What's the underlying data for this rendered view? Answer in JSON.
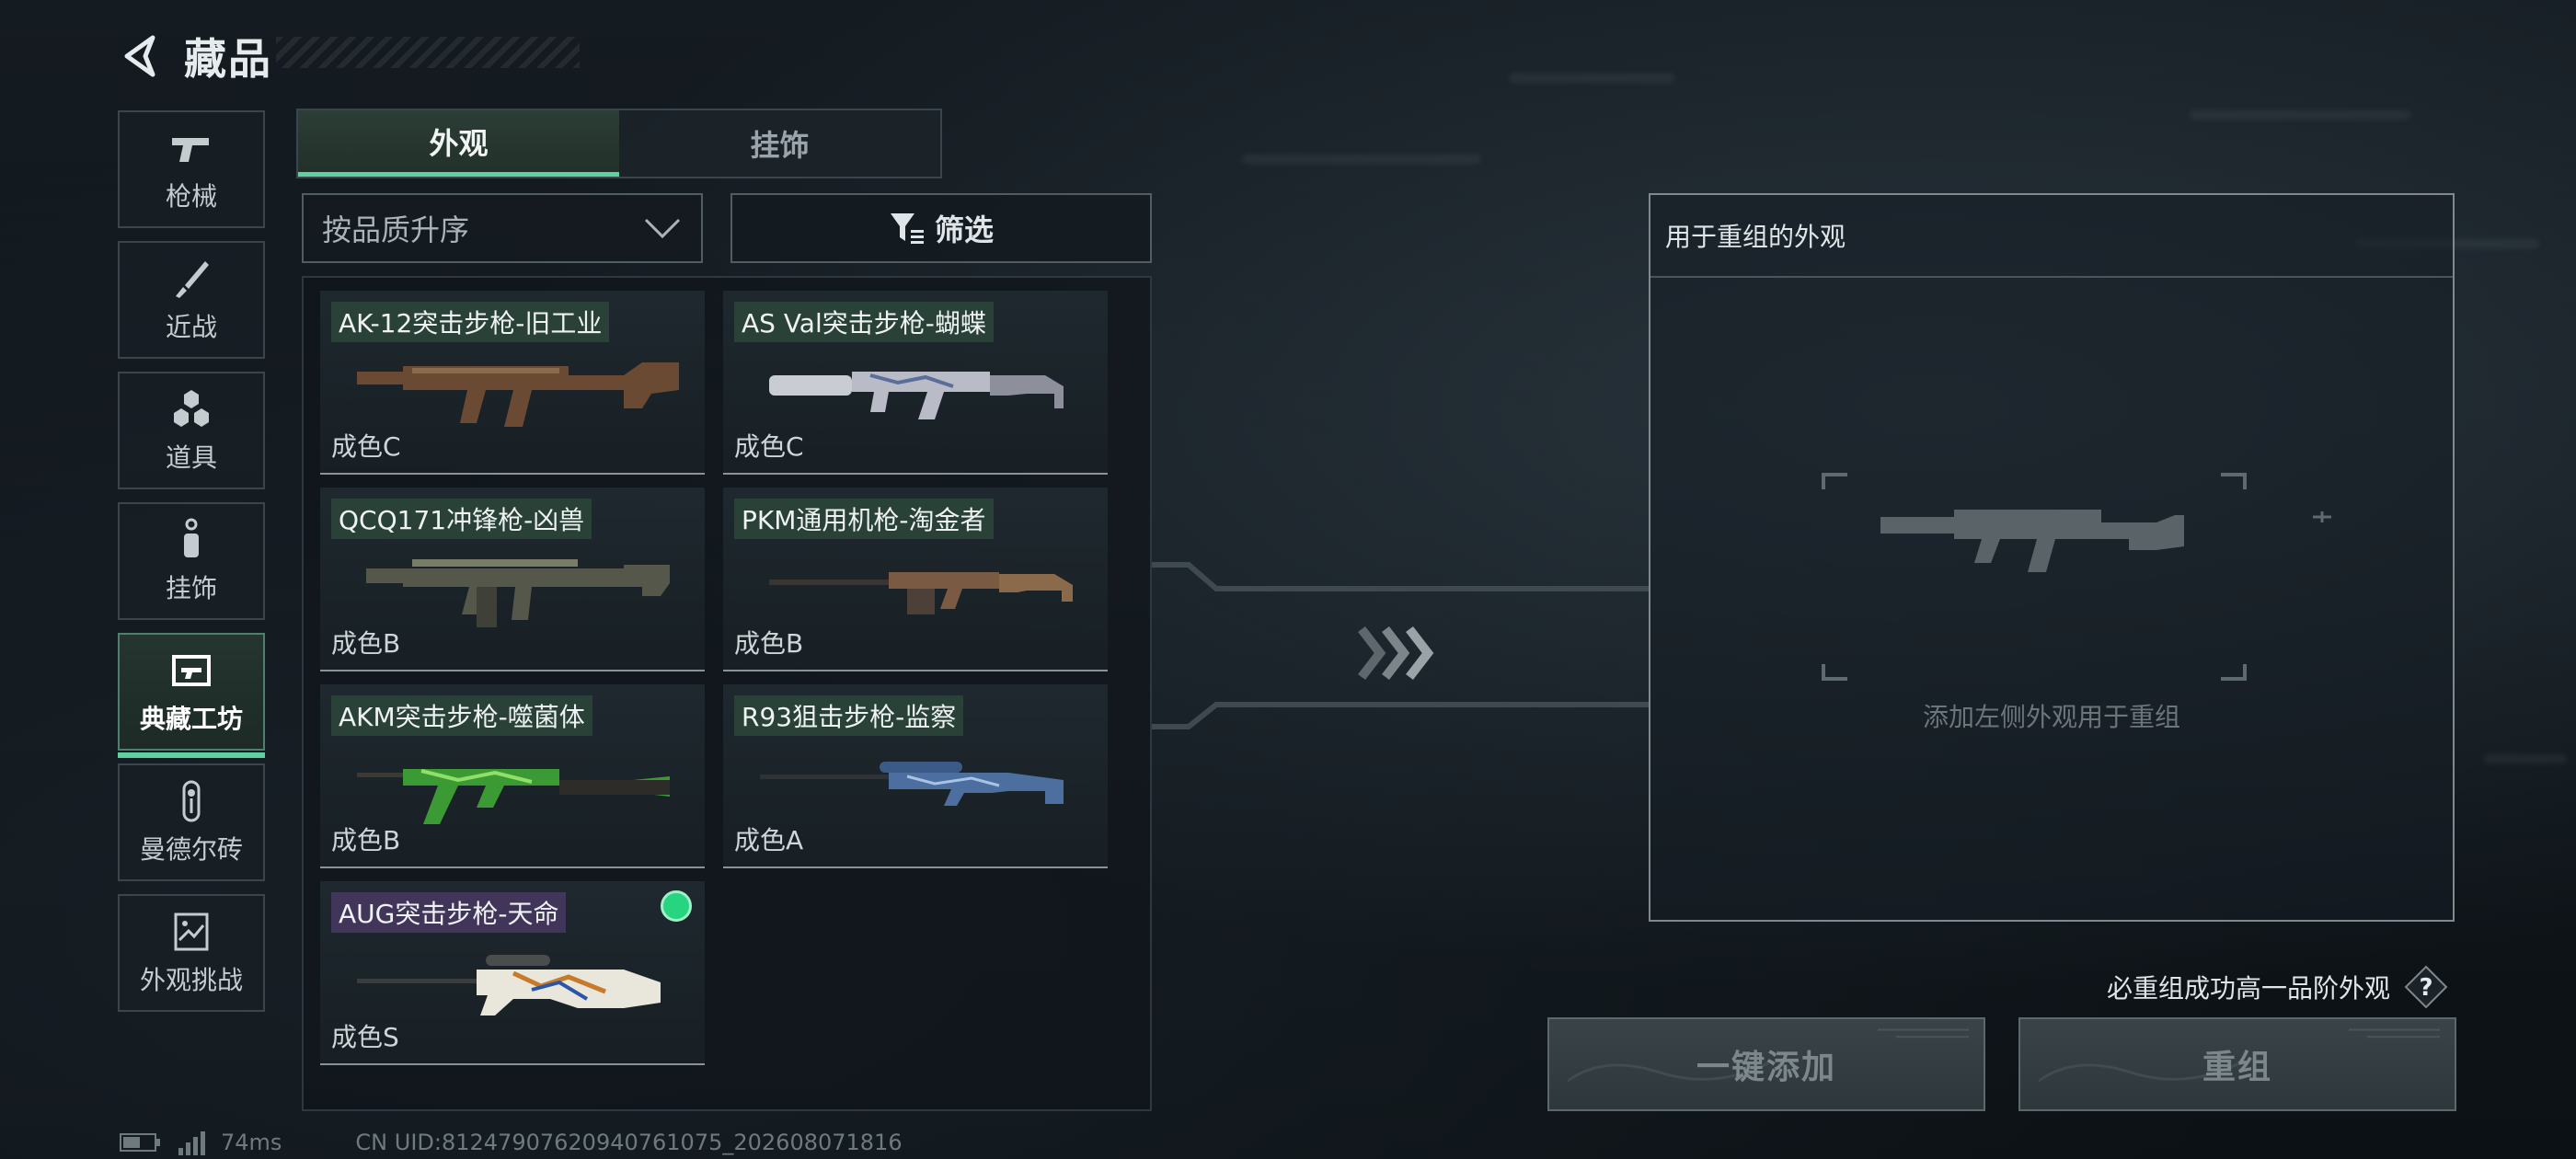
{
  "header": {
    "title": "藏品"
  },
  "sidebar": {
    "items": [
      {
        "label": "枪械",
        "icon": "pistol-icon",
        "active": false
      },
      {
        "label": "近战",
        "icon": "knife-icon",
        "active": false
      },
      {
        "label": "道具",
        "icon": "grenades-icon",
        "active": false
      },
      {
        "label": "挂饰",
        "icon": "charm-tag-icon",
        "active": false
      },
      {
        "label": "典藏工坊",
        "icon": "workshop-frame-icon",
        "active": true
      },
      {
        "label": "曼德尔砖",
        "icon": "mandel-brick-icon",
        "active": false
      },
      {
        "label": "外观挑战",
        "icon": "challenge-map-icon",
        "active": false
      }
    ]
  },
  "tabs": [
    {
      "label": "外观",
      "active": true
    },
    {
      "label": "挂饰",
      "active": false
    }
  ],
  "sort": {
    "selected": "按品质升序"
  },
  "filter": {
    "label": "筛选"
  },
  "items": [
    {
      "name": "AK-12突击步枪-旧工业",
      "grade": "成色C"
    },
    {
      "name": "AS Val突击步枪-蝴蝶",
      "grade": "成色C"
    },
    {
      "name": "QCQ171冲锋枪-凶兽",
      "grade": "成色B"
    },
    {
      "name": "PKM通用机枪-淘金者",
      "grade": "成色B"
    },
    {
      "name": "AKM突击步枪-噬菌体",
      "grade": "成色B"
    },
    {
      "name": "R93狙击步枪-监察",
      "grade": "成色A"
    },
    {
      "name": "AUG突击步枪-天命",
      "grade": "成色S",
      "selected": true
    }
  ],
  "recombine": {
    "header": "用于重组的外观",
    "hint": "添加左侧外观用于重组"
  },
  "guarantee": {
    "text": "必重组成功高一品阶外观",
    "help": "?"
  },
  "buttons": {
    "add_all": "一键添加",
    "recombine": "重组"
  },
  "status": {
    "ping": "74ms",
    "uid": "CN UID:81247907620940761075_202608071816"
  },
  "colors": {
    "accent": "#5fd0a0",
    "selected_dot": "#27d480",
    "purple_tag": "#46375f"
  }
}
